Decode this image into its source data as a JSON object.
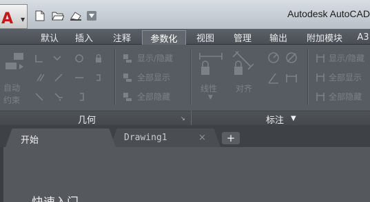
{
  "title_bar": {
    "app_title": "Autodesk AutoCAD",
    "app_logo_text": "A",
    "quick_access": [
      "new-icon",
      "open-icon",
      "save-icon"
    ]
  },
  "ribbon_tabs": [
    {
      "label": "默认"
    },
    {
      "label": "插入"
    },
    {
      "label": "注释"
    },
    {
      "label": "参数化",
      "active": true
    },
    {
      "label": "视图"
    },
    {
      "label": "管理"
    },
    {
      "label": "输出"
    },
    {
      "label": "附加模块"
    },
    {
      "label": "A3"
    }
  ],
  "geometric_panel": {
    "caption": "几何",
    "auto_constrain_label_1": "自动",
    "auto_constrain_label_2": "约束",
    "show_hide": "显示/隐藏",
    "show_all": "全部显示",
    "hide_all": "全部隐藏"
  },
  "dimensional_panel": {
    "caption": "标注",
    "linear_label": "线性",
    "aligned_label": "对齐",
    "show_hide": "显示/隐藏",
    "show_all": "全部显示",
    "hide_all": "全部隐藏"
  },
  "document_tabs": [
    {
      "label": "开始",
      "active": true
    },
    {
      "label": "Drawing1",
      "close": "×"
    }
  ],
  "new_tab_label": "+",
  "content": {
    "heading": "快速入门"
  },
  "colors": {
    "ribbon_bg": "#575c62",
    "active_tab_bg": "#62676e",
    "logo_red": "#c21a1a"
  }
}
